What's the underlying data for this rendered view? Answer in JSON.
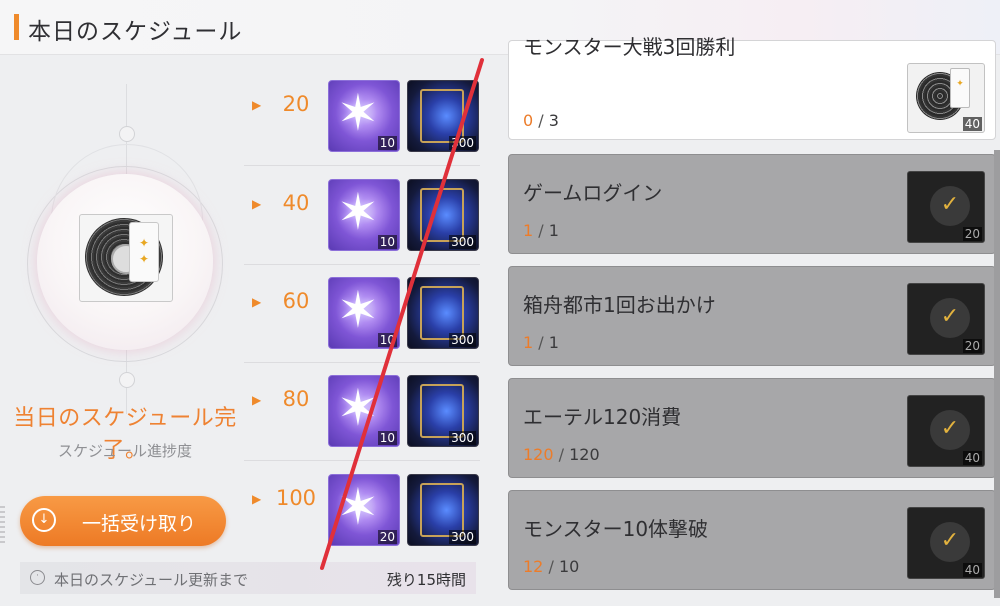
{
  "header": {
    "title": "本日のスケジュール"
  },
  "left_panel": {
    "status_text": "当日のスケジュール完了。",
    "progress_label": "スケジュール進捗度",
    "bulk_button_label": "一括受け取り",
    "bulk_icon": "download-circle-icon"
  },
  "tiers": [
    {
      "points": "20",
      "crystal_count": "10",
      "book_count": "300"
    },
    {
      "points": "40",
      "crystal_count": "10",
      "book_count": "300"
    },
    {
      "points": "60",
      "crystal_count": "10",
      "book_count": "300"
    },
    {
      "points": "80",
      "crystal_count": "10",
      "book_count": "300"
    },
    {
      "points": "100",
      "crystal_count": "20",
      "book_count": "300"
    }
  ],
  "missions": [
    {
      "title": "モンスター大戦3回勝利",
      "current": "0",
      "total": "3",
      "reward": "40",
      "state": "active",
      "icon": "disc-icon"
    },
    {
      "title": "ゲームログイン",
      "current": "1",
      "total": "1",
      "reward": "20",
      "state": "done",
      "icon": "check-icon"
    },
    {
      "title": "箱舟都市1回お出かけ",
      "current": "1",
      "total": "1",
      "reward": "20",
      "state": "done",
      "icon": "check-icon"
    },
    {
      "title": "エーテル120消費",
      "current": "120",
      "total": "120",
      "reward": "40",
      "state": "done",
      "icon": "check-icon"
    },
    {
      "title": "モンスター10体撃破",
      "current": "12",
      "total": "10",
      "reward": "40",
      "state": "done",
      "icon": "check-icon"
    }
  ],
  "footer": {
    "label": "本日のスケジュール更新まで",
    "remaining": "残り15時間",
    "icon": "clock-icon"
  },
  "colors": {
    "accent": "#ef8a2b",
    "done_card": "#a7a7a9",
    "annotation_stroke": "#e0303a"
  },
  "separator": "/"
}
